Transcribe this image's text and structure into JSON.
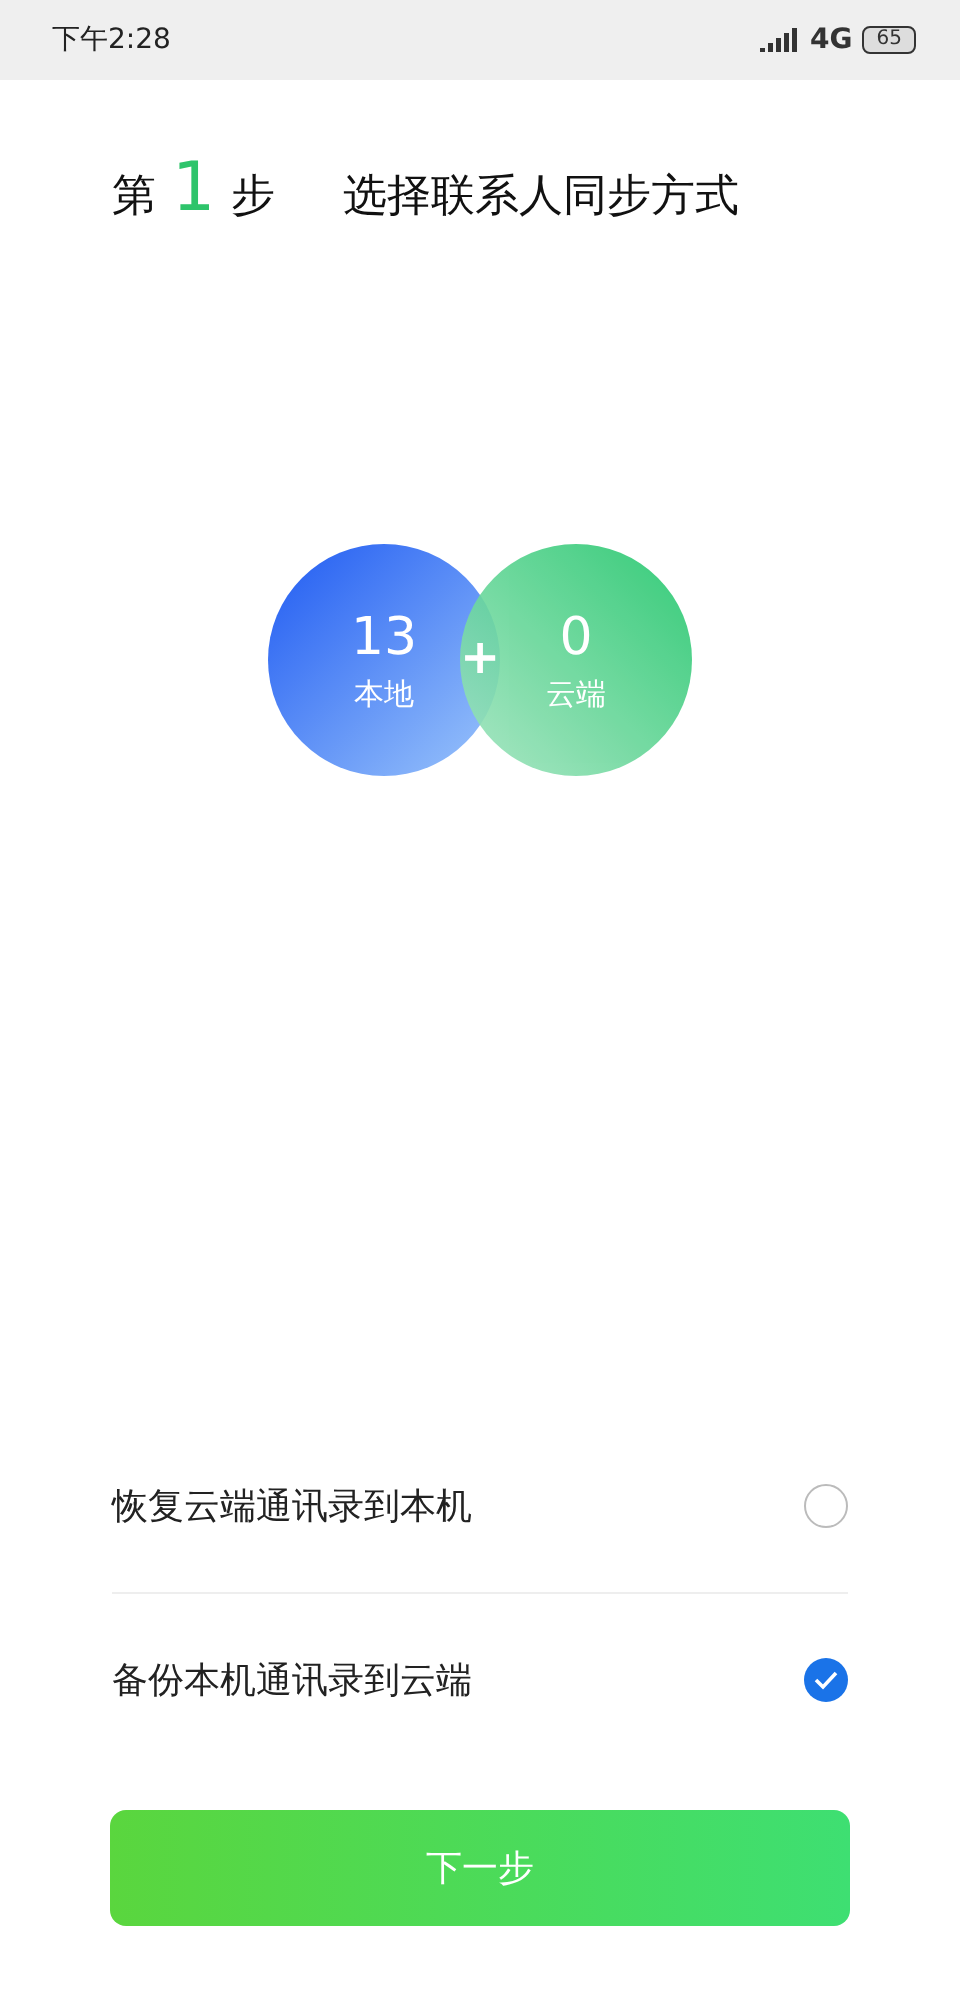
{
  "status_bar": {
    "time": "下午2:28",
    "network": "4G",
    "battery": "65"
  },
  "step": {
    "prefix": "第",
    "number": "1",
    "suffix": "步",
    "title": "选择联系人同步方式"
  },
  "summary": {
    "joiner": "+",
    "circles": [
      {
        "kind": "local",
        "count": "13",
        "label": "本地"
      },
      {
        "kind": "cloud",
        "count": "0",
        "label": "云端"
      }
    ]
  },
  "options": [
    {
      "label": "恢复云端通讯录到本机",
      "selected": false
    },
    {
      "label": "备份本机通讯录到云端",
      "selected": true
    }
  ],
  "button": {
    "label": "下一步"
  }
}
